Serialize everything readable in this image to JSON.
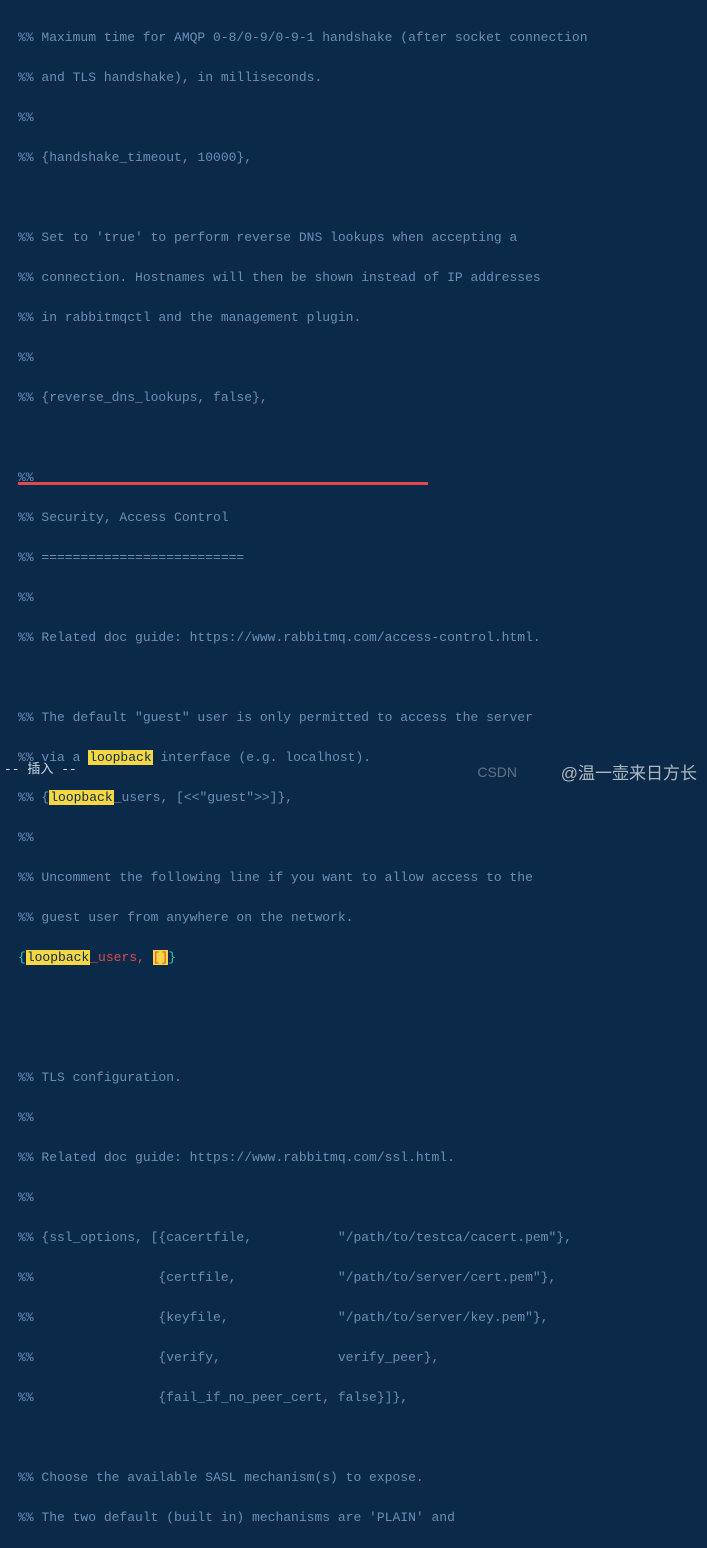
{
  "lines": {
    "l01": "%% Maximum time for AMQP 0-8/0-9/0-9-1 handshake (after socket connection",
    "l02": "%% and TLS handshake), in milliseconds.",
    "l03": "%%",
    "l04": "%% {handshake_timeout, 10000},",
    "l05": "",
    "l06": "%% Set to 'true' to perform reverse DNS lookups when accepting a",
    "l07": "%% connection. Hostnames will then be shown instead of IP addresses",
    "l08": "%% in rabbitmqctl and the management plugin.",
    "l09": "%%",
    "l10": "%% {reverse_dns_lookups, false},",
    "l11": "",
    "l12": "%%",
    "l13": "%% Security, Access Control",
    "l14": "%% ==========================",
    "l15": "%%",
    "l16": "%% Related doc guide: https://www.rabbitmq.com/access-control.html.",
    "l17": "",
    "l18a": "%% The default \"guest\" user is only permitted to access the server",
    "l19a": "%% via a ",
    "l19b": "loopback",
    "l19c": " interface (e.g. localhost).",
    "l20a": "%% {",
    "l20b": "loopback",
    "l20c": "_users, [<<\"guest\">>]},",
    "l21": "%%",
    "l22": "%% Uncomment the following line if you want to allow access to the",
    "l23": "%% guest user from anywhere on the network.",
    "l24a": "{",
    "l24b": "loopback",
    "l24c": "_users",
    "l24d": ", ",
    "l24e": "[",
    "l24f": "]",
    "l24g": "}",
    "l25": "",
    "l26": "",
    "l27": "%% TLS configuration.",
    "l28": "%%",
    "l29": "%% Related doc guide: https://www.rabbitmq.com/ssl.html.",
    "l30": "%%",
    "l31": "%% {ssl_options, [{cacertfile,           \"/path/to/testca/cacert.pem\"},",
    "l32": "%%                {certfile,             \"/path/to/server/cert.pem\"},",
    "l33": "%%                {keyfile,              \"/path/to/server/key.pem\"},",
    "l34": "%%                {verify,               verify_peer},",
    "l35": "%%                {fail_if_no_peer_cert, false}]},",
    "l36": "",
    "l37": "%% Choose the available SASL mechanism(s) to expose.",
    "l38": "%% The two default (built in) mechanisms are 'PLAIN' and"
  },
  "status": "-- 插入 --",
  "watermark_left": "CSDN",
  "watermark_right": "@温一壶来日方长"
}
